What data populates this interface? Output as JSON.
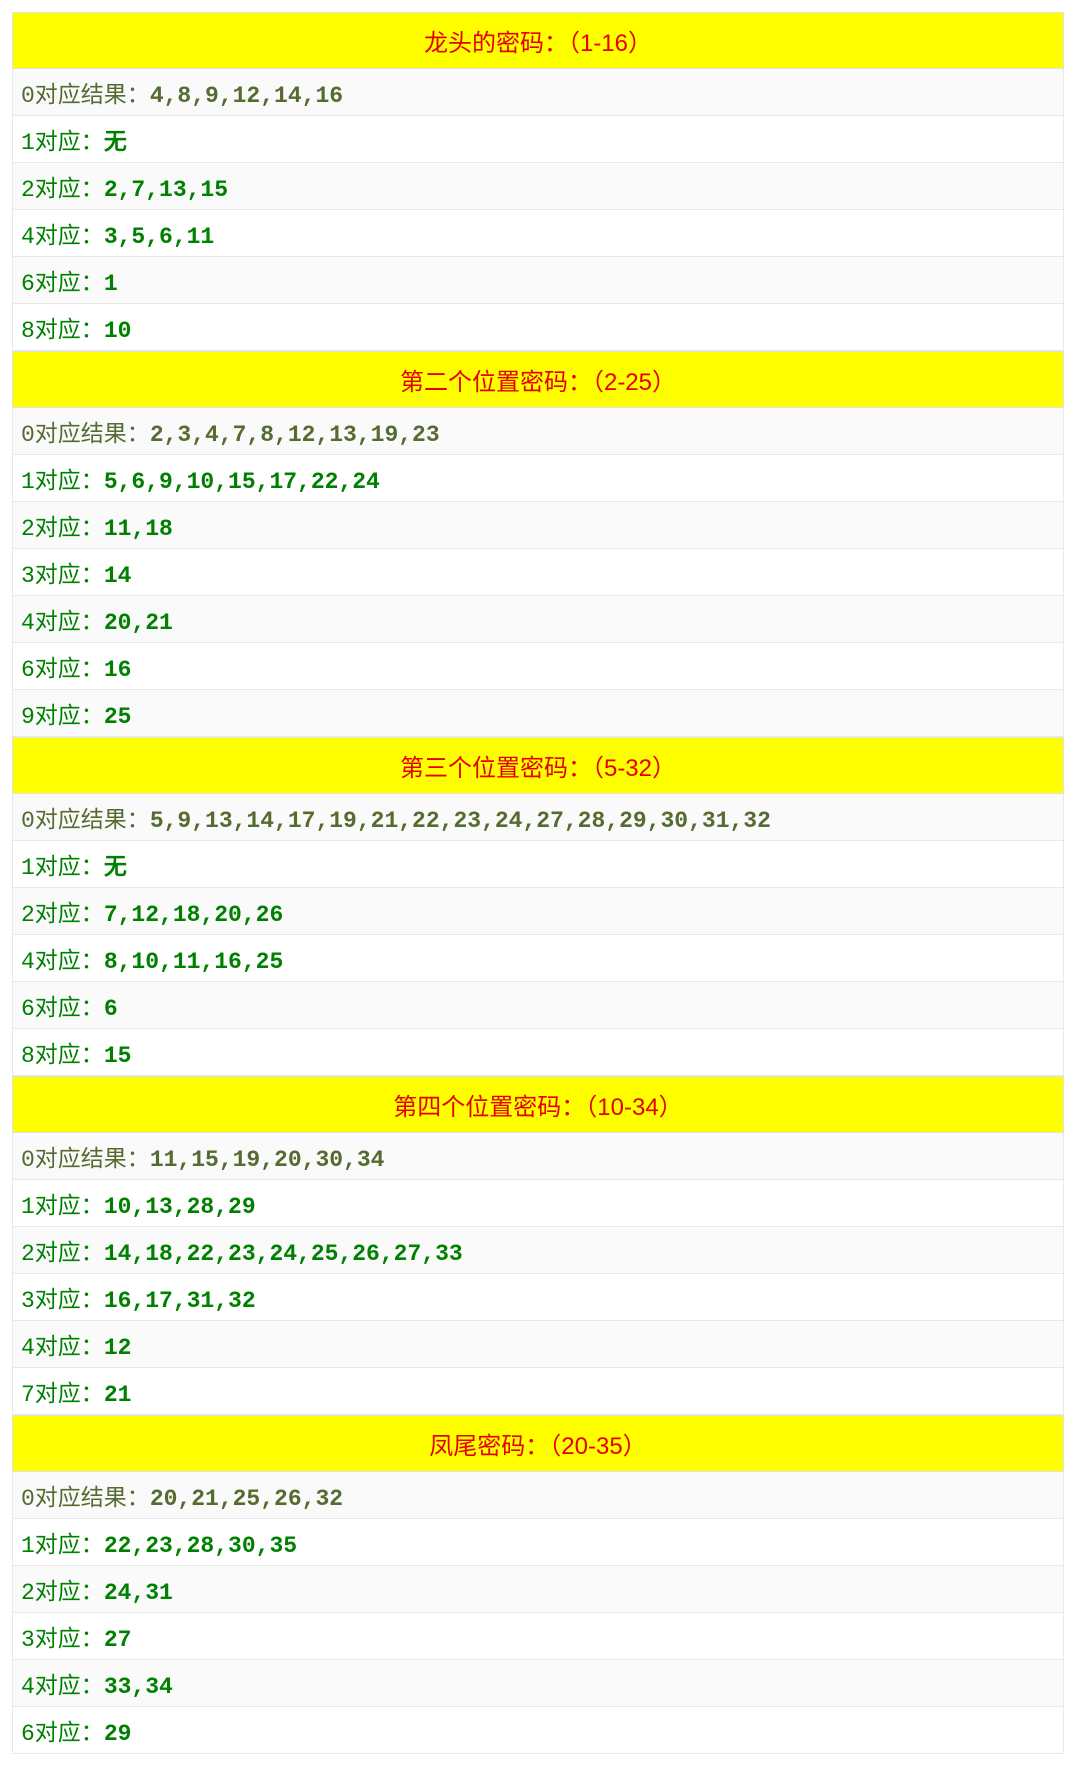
{
  "sections": [
    {
      "title": "龙头的密码：（1-16）",
      "rows": [
        {
          "key": "0对应结果：",
          "value": "4,8,9,12,14,16",
          "first": true
        },
        {
          "key": "1对应：",
          "value": "无"
        },
        {
          "key": "2对应：",
          "value": "2,7,13,15"
        },
        {
          "key": "4对应：",
          "value": "3,5,6,11"
        },
        {
          "key": "6对应：",
          "value": "1"
        },
        {
          "key": "8对应：",
          "value": "10"
        }
      ]
    },
    {
      "title": "第二个位置密码：（2-25）",
      "rows": [
        {
          "key": "0对应结果：",
          "value": "2,3,4,7,8,12,13,19,23",
          "first": true
        },
        {
          "key": "1对应：",
          "value": "5,6,9,10,15,17,22,24"
        },
        {
          "key": "2对应：",
          "value": "11,18"
        },
        {
          "key": "3对应：",
          "value": "14"
        },
        {
          "key": "4对应：",
          "value": "20,21"
        },
        {
          "key": "6对应：",
          "value": "16"
        },
        {
          "key": "9对应：",
          "value": "25"
        }
      ]
    },
    {
      "title": "第三个位置密码：（5-32）",
      "rows": [
        {
          "key": "0对应结果：",
          "value": "5,9,13,14,17,19,21,22,23,24,27,28,29,30,31,32",
          "first": true
        },
        {
          "key": "1对应：",
          "value": "无"
        },
        {
          "key": "2对应：",
          "value": "7,12,18,20,26"
        },
        {
          "key": "4对应：",
          "value": "8,10,11,16,25"
        },
        {
          "key": "6对应：",
          "value": "6"
        },
        {
          "key": "8对应：",
          "value": "15"
        }
      ]
    },
    {
      "title": "第四个位置密码：（10-34）",
      "rows": [
        {
          "key": "0对应结果：",
          "value": "11,15,19,20,30,34",
          "first": true
        },
        {
          "key": "1对应：",
          "value": "10,13,28,29"
        },
        {
          "key": "2对应：",
          "value": "14,18,22,23,24,25,26,27,33"
        },
        {
          "key": "3对应：",
          "value": "16,17,31,32"
        },
        {
          "key": "4对应：",
          "value": "12"
        },
        {
          "key": "7对应：",
          "value": "21"
        }
      ]
    },
    {
      "title": "凤尾密码：（20-35）",
      "rows": [
        {
          "key": "0对应结果：",
          "value": "20,21,25,26,32",
          "first": true
        },
        {
          "key": "1对应：",
          "value": "22,23,28,30,35"
        },
        {
          "key": "2对应：",
          "value": "24,31"
        },
        {
          "key": "3对应：",
          "value": "27"
        },
        {
          "key": "4对应：",
          "value": "33,34"
        },
        {
          "key": "6对应：",
          "value": "29"
        }
      ]
    }
  ]
}
